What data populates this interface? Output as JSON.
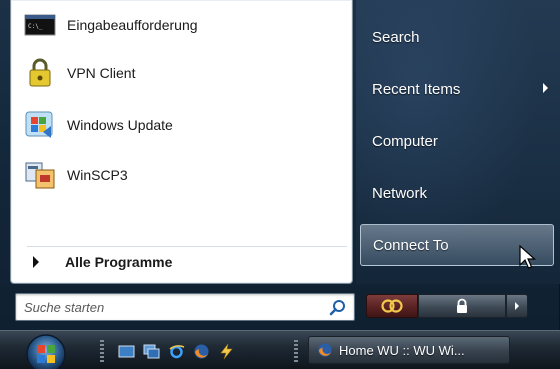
{
  "programs": [
    {
      "label": "Eingabeaufforderung",
      "icon": "command-prompt-icon"
    },
    {
      "label": "VPN Client",
      "icon": "vpn-lock-icon"
    },
    {
      "label": "Windows Update",
      "icon": "windows-update-icon"
    },
    {
      "label": "WinSCP3",
      "icon": "winscp-icon"
    }
  ],
  "all_programs_label": "Alle Programme",
  "search": {
    "placeholder": "Suche starten"
  },
  "places": [
    {
      "label": "Search"
    },
    {
      "label": "Recent Items",
      "has_submenu": true
    },
    {
      "label": "Computer"
    },
    {
      "label": "Network"
    },
    {
      "label": "Connect To",
      "highlighted": true
    }
  ],
  "taskbar": {
    "quick_launch": [
      "show-desktop-icon",
      "switch-windows-icon",
      "internet-explorer-icon",
      "firefox-icon",
      "lightning-icon"
    ],
    "task_button_label": "Home WU :: WU Wi..."
  },
  "colors": {
    "menu_panel": "#ffffff",
    "places_panel": "#1c3146",
    "power_button": "#5a2222",
    "lock_button": "#3e4a56",
    "taskbar": "#1f2a35"
  }
}
